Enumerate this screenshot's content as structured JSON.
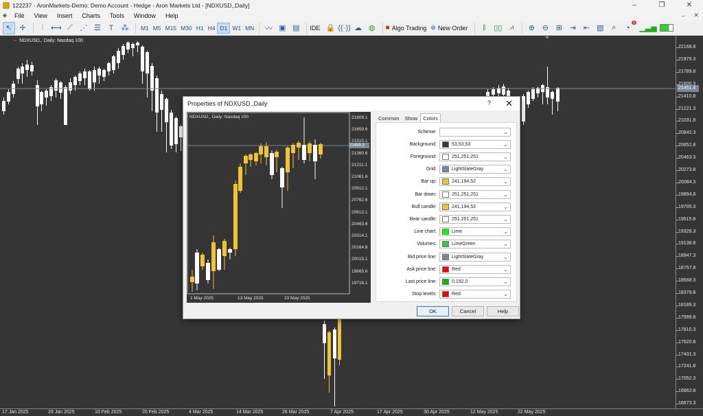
{
  "window": {
    "title": "122237 - AronMarkets-Demo: Demo Account - Hedge - Aron Markets Ltd - [NDXUSD,,Daily]",
    "controls": [
      "–",
      "❐",
      "✕"
    ]
  },
  "menu": [
    "File",
    "View",
    "Insert",
    "Charts",
    "Tools",
    "Window",
    "Help"
  ],
  "toolbar": {
    "timeframes": [
      "M1",
      "M5",
      "M15",
      "M30",
      "H1",
      "H4",
      "D1",
      "W1",
      "MN"
    ],
    "selected_timeframe": "D1",
    "ide_label": "IDE",
    "algo_trading_label": "Algo Trading",
    "new_order_label": "New Order",
    "notification_count": "1"
  },
  "chart": {
    "symbol_label": "NDXUSD,, Daily:  Nasdaq 100",
    "current_price": "21451.4",
    "y_labels": [
      "22168.8",
      "21979.3",
      "21789.8",
      "21600.3",
      "21410.8",
      "21221.3",
      "21031.8",
      "20842.3",
      "20652.8",
      "20463.3",
      "20273.8",
      "20084.3",
      "19894.8",
      "19705.3",
      "19515.8",
      "19326.3",
      "19136.8",
      "18947.3",
      "18757.8",
      "18568.3",
      "18378.8",
      "18189.3",
      "17999.8",
      "17810.3",
      "17620.8",
      "17431.3",
      "17241.8",
      "17052.3",
      "16862.8",
      "16673.3",
      "16483.8"
    ],
    "x_labels": [
      "17 Jan 2025",
      "29 Jan 2025",
      "10 Feb 2025",
      "20 Feb 2025",
      "4 Mar 2025",
      "14 Mar 2025",
      "26 Mar 2025",
      "7 Apr 2025",
      "17 Apr 2025",
      "30 Apr 2025",
      "12 May 2025",
      "22 May 2025"
    ],
    "colors": {
      "background": "#353535",
      "bull": "#f1c234",
      "bear": "#fbfbfb",
      "grid": "#778899"
    }
  },
  "dialog": {
    "title": "Properties of NDXUSD,,Daily",
    "help_glyph": "?",
    "close_glyph": "✕",
    "tabs": [
      "Common",
      "Show",
      "Colors"
    ],
    "active_tab": "Colors",
    "preview": {
      "symbol_label": "NDXUSD,, Daily:  Nasdaq 100",
      "current_price": "21459.3",
      "y_labels": [
        "21809.1",
        "21659.6",
        "21510.1",
        "21360.6",
        "21211.1",
        "21061.6",
        "20912.1",
        "20762.6",
        "20613.1",
        "20463.6",
        "20314.1",
        "20164.6",
        "20015.1",
        "19865.6",
        "19716.1"
      ],
      "x_labels": [
        "1 May 2025",
        "13 May 2025",
        "23 May 2025"
      ]
    },
    "rows": [
      {
        "label": "Scheme:",
        "value": "",
        "color": ""
      },
      {
        "label": "Background:",
        "value": "53,53,53",
        "color": "#353535"
      },
      {
        "label": "Foreground:",
        "value": "251,251,251",
        "color": "#fbfbfb"
      },
      {
        "label": "Grid:",
        "value": "LightSlateGray",
        "color": "#778899"
      },
      {
        "label": "Bar up:",
        "value": "241,194,52",
        "color": "#f1c234"
      },
      {
        "label": "Bar down:",
        "value": "251,251,251",
        "color": "#fbfbfb"
      },
      {
        "label": "Bull candle:",
        "value": "241,194,52",
        "color": "#f1c234"
      },
      {
        "label": "Bear candle:",
        "value": "251,251,251",
        "color": "#fbfbfb"
      },
      {
        "label": "Line chart:",
        "value": "Lime",
        "color": "#00ff00"
      },
      {
        "label": "Volumes:",
        "value": "LimeGreen",
        "color": "#32cd32"
      },
      {
        "label": "Bid price line:",
        "value": "LightSlateGray",
        "color": "#778899"
      },
      {
        "label": "Ask price line:",
        "value": "Red",
        "color": "#ff0000"
      },
      {
        "label": "Last price line:",
        "value": "0,192,0",
        "color": "#00c000"
      },
      {
        "label": "Stop levels:",
        "value": "Red",
        "color": "#ff0000"
      }
    ],
    "buttons": {
      "ok": "OK",
      "cancel": "Cancel",
      "help": "Help"
    }
  }
}
